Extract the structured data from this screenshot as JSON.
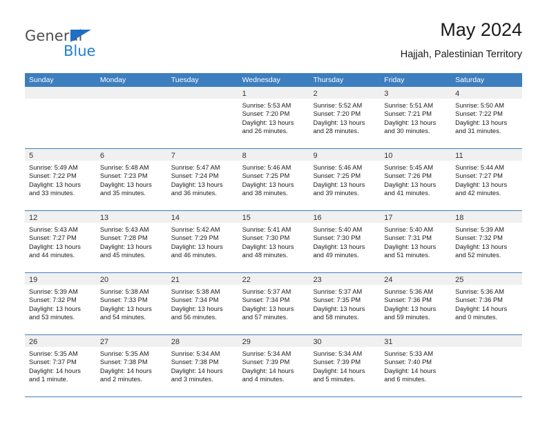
{
  "logo": {
    "word_one": "General",
    "word_two": "Blue",
    "triangle_icon": "blue-triangle-icon",
    "brand_blue": "#1f7fd4",
    "brand_gray": "#4d4d4d"
  },
  "header": {
    "title": "May 2024",
    "subtitle": "Hajjah, Palestinian Territory"
  },
  "calendar": {
    "header_bg": "#3d7ebf",
    "row_border": "#3d7ebf",
    "day_band_bg": "#f0f0f0",
    "weekdays": [
      "Sunday",
      "Monday",
      "Tuesday",
      "Wednesday",
      "Thursday",
      "Friday",
      "Saturday"
    ],
    "weeks": [
      [
        {
          "day": "",
          "lines": []
        },
        {
          "day": "",
          "lines": []
        },
        {
          "day": "",
          "lines": []
        },
        {
          "day": "1",
          "lines": [
            "Sunrise: 5:53 AM",
            "Sunset: 7:20 PM",
            "Daylight: 13 hours",
            "and 26 minutes."
          ]
        },
        {
          "day": "2",
          "lines": [
            "Sunrise: 5:52 AM",
            "Sunset: 7:20 PM",
            "Daylight: 13 hours",
            "and 28 minutes."
          ]
        },
        {
          "day": "3",
          "lines": [
            "Sunrise: 5:51 AM",
            "Sunset: 7:21 PM",
            "Daylight: 13 hours",
            "and 30 minutes."
          ]
        },
        {
          "day": "4",
          "lines": [
            "Sunrise: 5:50 AM",
            "Sunset: 7:22 PM",
            "Daylight: 13 hours",
            "and 31 minutes."
          ]
        }
      ],
      [
        {
          "day": "5",
          "lines": [
            "Sunrise: 5:49 AM",
            "Sunset: 7:22 PM",
            "Daylight: 13 hours",
            "and 33 minutes."
          ]
        },
        {
          "day": "6",
          "lines": [
            "Sunrise: 5:48 AM",
            "Sunset: 7:23 PM",
            "Daylight: 13 hours",
            "and 35 minutes."
          ]
        },
        {
          "day": "7",
          "lines": [
            "Sunrise: 5:47 AM",
            "Sunset: 7:24 PM",
            "Daylight: 13 hours",
            "and 36 minutes."
          ]
        },
        {
          "day": "8",
          "lines": [
            "Sunrise: 5:46 AM",
            "Sunset: 7:25 PM",
            "Daylight: 13 hours",
            "and 38 minutes."
          ]
        },
        {
          "day": "9",
          "lines": [
            "Sunrise: 5:46 AM",
            "Sunset: 7:25 PM",
            "Daylight: 13 hours",
            "and 39 minutes."
          ]
        },
        {
          "day": "10",
          "lines": [
            "Sunrise: 5:45 AM",
            "Sunset: 7:26 PM",
            "Daylight: 13 hours",
            "and 41 minutes."
          ]
        },
        {
          "day": "11",
          "lines": [
            "Sunrise: 5:44 AM",
            "Sunset: 7:27 PM",
            "Daylight: 13 hours",
            "and 42 minutes."
          ]
        }
      ],
      [
        {
          "day": "12",
          "lines": [
            "Sunrise: 5:43 AM",
            "Sunset: 7:27 PM",
            "Daylight: 13 hours",
            "and 44 minutes."
          ]
        },
        {
          "day": "13",
          "lines": [
            "Sunrise: 5:43 AM",
            "Sunset: 7:28 PM",
            "Daylight: 13 hours",
            "and 45 minutes."
          ]
        },
        {
          "day": "14",
          "lines": [
            "Sunrise: 5:42 AM",
            "Sunset: 7:29 PM",
            "Daylight: 13 hours",
            "and 46 minutes."
          ]
        },
        {
          "day": "15",
          "lines": [
            "Sunrise: 5:41 AM",
            "Sunset: 7:30 PM",
            "Daylight: 13 hours",
            "and 48 minutes."
          ]
        },
        {
          "day": "16",
          "lines": [
            "Sunrise: 5:40 AM",
            "Sunset: 7:30 PM",
            "Daylight: 13 hours",
            "and 49 minutes."
          ]
        },
        {
          "day": "17",
          "lines": [
            "Sunrise: 5:40 AM",
            "Sunset: 7:31 PM",
            "Daylight: 13 hours",
            "and 51 minutes."
          ]
        },
        {
          "day": "18",
          "lines": [
            "Sunrise: 5:39 AM",
            "Sunset: 7:32 PM",
            "Daylight: 13 hours",
            "and 52 minutes."
          ]
        }
      ],
      [
        {
          "day": "19",
          "lines": [
            "Sunrise: 5:39 AM",
            "Sunset: 7:32 PM",
            "Daylight: 13 hours",
            "and 53 minutes."
          ]
        },
        {
          "day": "20",
          "lines": [
            "Sunrise: 5:38 AM",
            "Sunset: 7:33 PM",
            "Daylight: 13 hours",
            "and 54 minutes."
          ]
        },
        {
          "day": "21",
          "lines": [
            "Sunrise: 5:38 AM",
            "Sunset: 7:34 PM",
            "Daylight: 13 hours",
            "and 56 minutes."
          ]
        },
        {
          "day": "22",
          "lines": [
            "Sunrise: 5:37 AM",
            "Sunset: 7:34 PM",
            "Daylight: 13 hours",
            "and 57 minutes."
          ]
        },
        {
          "day": "23",
          "lines": [
            "Sunrise: 5:37 AM",
            "Sunset: 7:35 PM",
            "Daylight: 13 hours",
            "and 58 minutes."
          ]
        },
        {
          "day": "24",
          "lines": [
            "Sunrise: 5:36 AM",
            "Sunset: 7:36 PM",
            "Daylight: 13 hours",
            "and 59 minutes."
          ]
        },
        {
          "day": "25",
          "lines": [
            "Sunrise: 5:36 AM",
            "Sunset: 7:36 PM",
            "Daylight: 14 hours",
            "and 0 minutes."
          ]
        }
      ],
      [
        {
          "day": "26",
          "lines": [
            "Sunrise: 5:35 AM",
            "Sunset: 7:37 PM",
            "Daylight: 14 hours",
            "and 1 minute."
          ]
        },
        {
          "day": "27",
          "lines": [
            "Sunrise: 5:35 AM",
            "Sunset: 7:38 PM",
            "Daylight: 14 hours",
            "and 2 minutes."
          ]
        },
        {
          "day": "28",
          "lines": [
            "Sunrise: 5:34 AM",
            "Sunset: 7:38 PM",
            "Daylight: 14 hours",
            "and 3 minutes."
          ]
        },
        {
          "day": "29",
          "lines": [
            "Sunrise: 5:34 AM",
            "Sunset: 7:39 PM",
            "Daylight: 14 hours",
            "and 4 minutes."
          ]
        },
        {
          "day": "30",
          "lines": [
            "Sunrise: 5:34 AM",
            "Sunset: 7:39 PM",
            "Daylight: 14 hours",
            "and 5 minutes."
          ]
        },
        {
          "day": "31",
          "lines": [
            "Sunrise: 5:33 AM",
            "Sunset: 7:40 PM",
            "Daylight: 14 hours",
            "and 6 minutes."
          ]
        },
        {
          "day": "",
          "lines": []
        }
      ]
    ]
  }
}
